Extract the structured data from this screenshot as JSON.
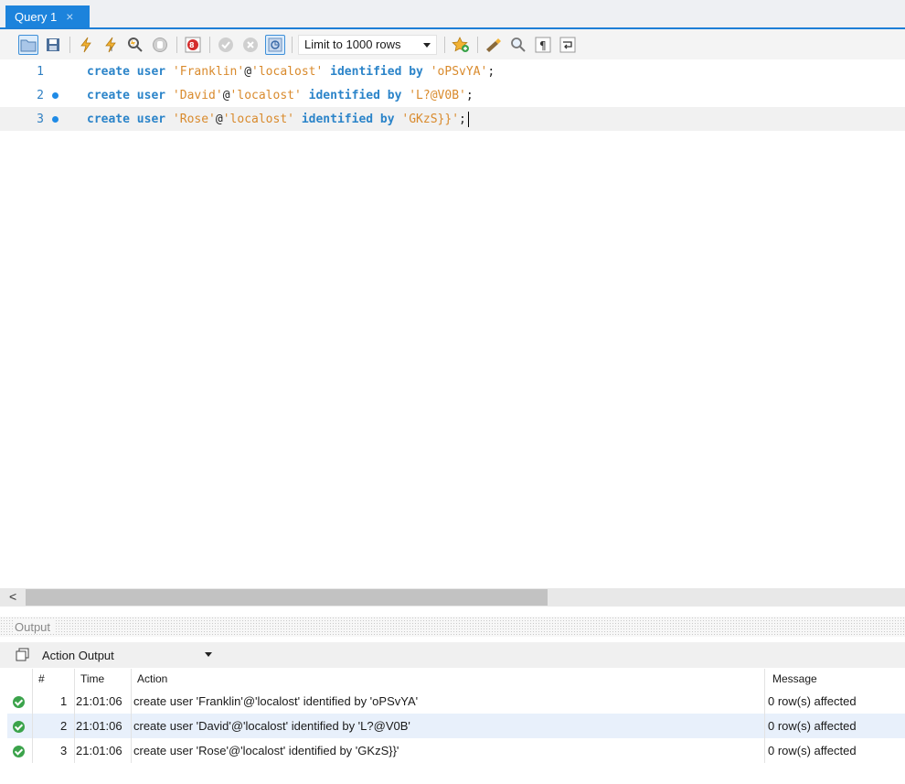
{
  "tab": {
    "title": "Query 1",
    "close": "×"
  },
  "toolbar": {
    "limit_selected": "Limit to 1000 rows",
    "icons": [
      "folder-icon",
      "save-icon",
      "execute-icon",
      "execute-current-icon",
      "explain-icon",
      "stop-icon",
      "toggle-error-icon",
      "commit-icon",
      "rollback-icon",
      "autocommit-icon",
      "bookmark-icon",
      "beautify-icon",
      "find-icon",
      "invisible-chars-icon",
      "wrap-icon"
    ]
  },
  "editor": {
    "lines": [
      {
        "num": "1",
        "marker": false,
        "current": false,
        "tokens": [
          {
            "t": "kw",
            "v": "create user"
          },
          {
            "t": "pl",
            "v": " "
          },
          {
            "t": "str",
            "v": "'Franklin'"
          },
          {
            "t": "pl",
            "v": "@"
          },
          {
            "t": "str",
            "v": "'localost'"
          },
          {
            "t": "pl",
            "v": " "
          },
          {
            "t": "kw",
            "v": "identified by"
          },
          {
            "t": "pl",
            "v": " "
          },
          {
            "t": "str",
            "v": "'oPSvYA'"
          },
          {
            "t": "pl",
            "v": ";"
          }
        ]
      },
      {
        "num": "2",
        "marker": true,
        "current": false,
        "tokens": [
          {
            "t": "kw",
            "v": "create user"
          },
          {
            "t": "pl",
            "v": " "
          },
          {
            "t": "str",
            "v": "'David'"
          },
          {
            "t": "pl",
            "v": "@"
          },
          {
            "t": "str",
            "v": "'localost'"
          },
          {
            "t": "pl",
            "v": " "
          },
          {
            "t": "kw",
            "v": "identified by"
          },
          {
            "t": "pl",
            "v": " "
          },
          {
            "t": "str",
            "v": "'L?@V0B'"
          },
          {
            "t": "pl",
            "v": ";"
          }
        ]
      },
      {
        "num": "3",
        "marker": true,
        "current": true,
        "tokens": [
          {
            "t": "kw",
            "v": "create user"
          },
          {
            "t": "pl",
            "v": " "
          },
          {
            "t": "str",
            "v": "'Rose'"
          },
          {
            "t": "pl",
            "v": "@"
          },
          {
            "t": "str",
            "v": "'localost'"
          },
          {
            "t": "pl",
            "v": " "
          },
          {
            "t": "kw",
            "v": "identified by"
          },
          {
            "t": "pl",
            "v": " "
          },
          {
            "t": "str",
            "v": "'GKzS}}'"
          },
          {
            "t": "pl",
            "v": ";"
          }
        ]
      }
    ]
  },
  "scroll": {
    "left_arrow": "<"
  },
  "output": {
    "header": "Output",
    "selected_view": "Action Output",
    "columns": {
      "num": "#",
      "time": "Time",
      "action": "Action",
      "message": "Message"
    },
    "rows": [
      {
        "num": "1",
        "time": "21:01:06",
        "action": "create user 'Franklin'@'localost' identified by 'oPSvYA'",
        "message": "0 row(s) affected"
      },
      {
        "num": "2",
        "time": "21:01:06",
        "action": "create user 'David'@'localost' identified by 'L?@V0B'",
        "message": "0 row(s) affected"
      },
      {
        "num": "3",
        "time": "21:01:06",
        "action": "create user 'Rose'@'localost' identified by 'GKzS}}'",
        "message": "0 row(s) affected"
      }
    ]
  },
  "colors": {
    "accent": "#1c83dc",
    "keyword": "#2b84c9",
    "string": "#d98a2c",
    "success": "#3ba34b",
    "row_alt": "#e8f0fb"
  }
}
